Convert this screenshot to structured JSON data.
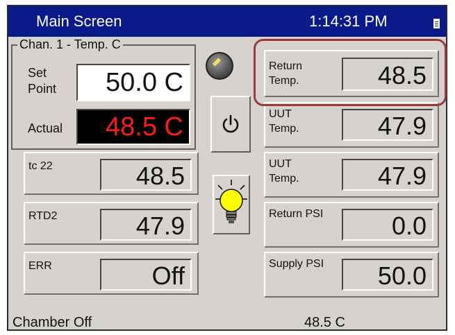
{
  "header": {
    "title": "Main Screen",
    "time": "1:14:31 PM",
    "keyboard_icon": "keyboard-icon"
  },
  "channel": {
    "group_label": "Chan. 1 - Temp. C",
    "set_point_label": "Set Point",
    "set_point_value": "50.0 C",
    "actual_label": "Actual",
    "actual_value": "48.5 C",
    "actual_color": "#ff1b1b"
  },
  "left_readings": [
    {
      "label": "tc 22",
      "value": "48.5"
    },
    {
      "label": "RTD2",
      "value": "47.9"
    },
    {
      "label": "ERR",
      "value": "Off"
    }
  ],
  "right_readings": [
    {
      "label": "Return Temp.",
      "value": "48.5"
    },
    {
      "label": "UUT Temp.",
      "value": "47.9"
    },
    {
      "label": "UUT Temp.",
      "value": "47.9"
    },
    {
      "label": "Return PSI",
      "value": "0.0"
    },
    {
      "label": "Supply PSI",
      "value": "50.0"
    }
  ],
  "controls": {
    "knob_icon": "knob-icon",
    "power_icon": "power-icon",
    "light_icon": "light-bulb-icon"
  },
  "status": {
    "left": "Chamber Off",
    "right": "48.5 C"
  },
  "colors": {
    "title_bar": "#0a1a8a",
    "panel": "#d6d3ce",
    "highlight": "#9a3a3a"
  }
}
